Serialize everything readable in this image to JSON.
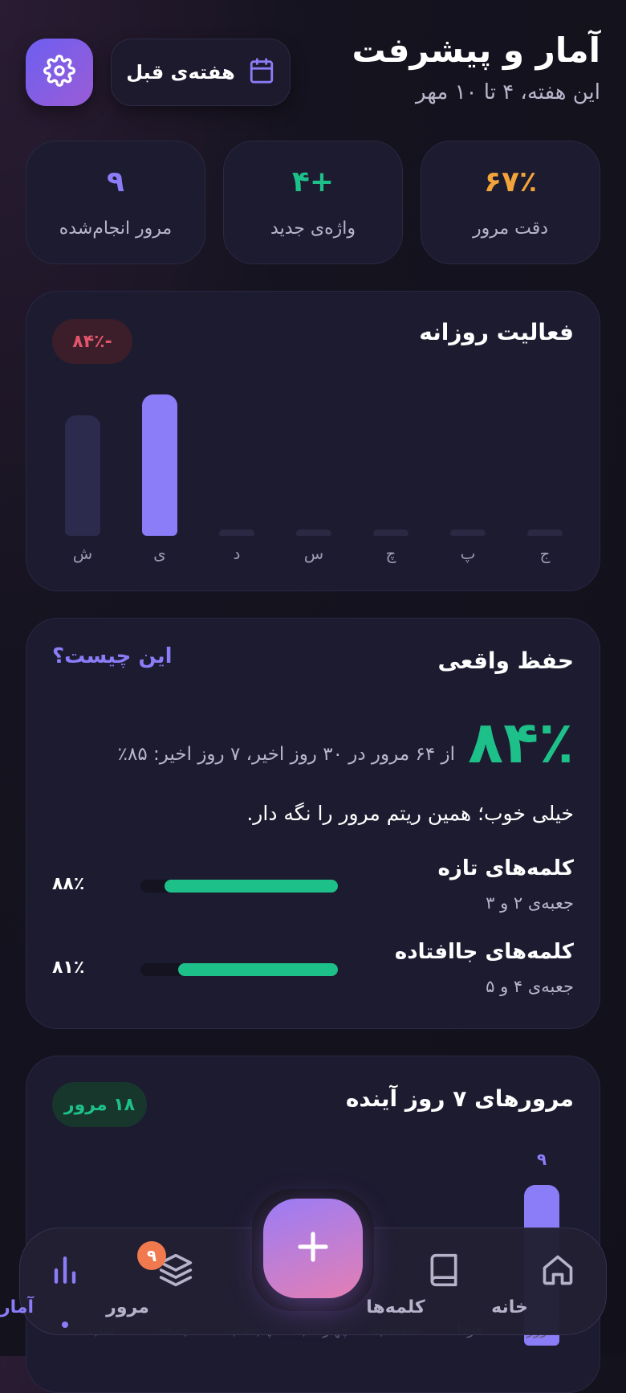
{
  "header": {
    "title": "آمار و پیشرفت",
    "subtitle": "این هفته، ۴ تا ۱۰ مهر",
    "week_button": "هفته‌ی قبل"
  },
  "stats": [
    {
      "value": "۶۷٪",
      "label": "دقت مرور",
      "color": "#f2a43a"
    },
    {
      "value": "+۴",
      "label": "واژه‌ی جدید",
      "color": "#1ec08a"
    },
    {
      "value": "۹",
      "label": "مرور انجام‌شده",
      "color": "#8b7cf8"
    }
  ],
  "daily": {
    "title": "فعالیت روزانه",
    "badge": "-۸۴٪",
    "days": [
      "ش",
      "ی",
      "د",
      "س",
      "چ",
      "پ",
      "ج"
    ],
    "values": [
      0.85,
      1.0,
      0.02,
      0.02,
      0.02,
      0.02,
      0.02
    ],
    "highlight_index": 1
  },
  "retention": {
    "title": "حفظ واقعی",
    "help_link": "این چیست؟",
    "big_value": "۸۴٪",
    "detail": "از ۶۴ مرور در ۳۰ روز اخیر، ۷ روز اخیر: ۸۵٪",
    "message": "خیلی خوب؛ همین ریتم مرور را نگه دار.",
    "rows": [
      {
        "title": "کلمه‌های تازه",
        "sub": "جعبه‌ی ۲ و ۳",
        "percent": "۸۸٪",
        "fraction": 0.88
      },
      {
        "title": "کلمه‌های جاافتاده",
        "sub": "جعبه‌ی ۴ و ۵",
        "percent": "۸۱٪",
        "fraction": 0.81
      }
    ]
  },
  "upcoming": {
    "title": "مرورهای ۷ روز آینده",
    "badge": "۱۸ مرور",
    "first_value": "۹",
    "day_labels": [
      "امروز",
      "فردا",
      "سه‌شنبه",
      "چهارشنبه",
      "پنجشنبه",
      "جمعه",
      "شنبه"
    ]
  },
  "nav": {
    "home": "خانه",
    "words": "کلمه‌ها",
    "review": "مرور",
    "review_badge": "۹",
    "stats": "آمار"
  },
  "colors": {
    "accent": "#8b7cf8",
    "green": "#1ec08a",
    "orange": "#f2a43a",
    "red": "#e0556b"
  }
}
